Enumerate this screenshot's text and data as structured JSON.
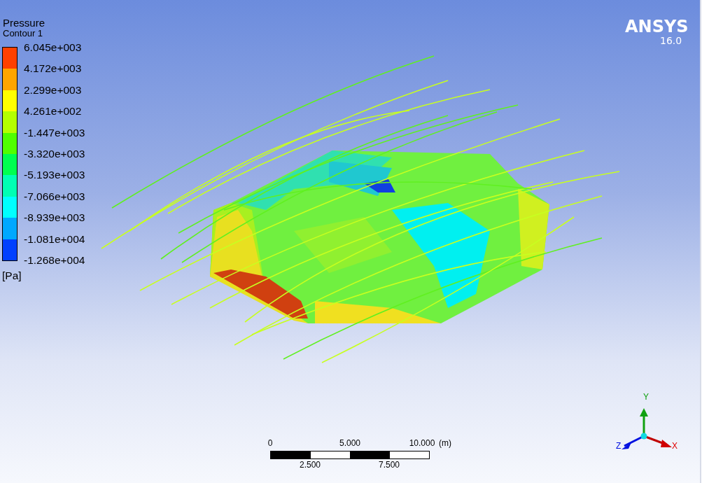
{
  "legend": {
    "title": "Pressure",
    "subtitle": "Contour 1",
    "labels": [
      "6.045e+003",
      "4.172e+003",
      "2.299e+003",
      "4.261e+002",
      "-1.447e+003",
      "-3.320e+003",
      "-5.193e+003",
      "-7.066e+003",
      "-8.939e+003",
      "-1.081e+004",
      "-1.268e+004"
    ],
    "bands": [
      {
        "color": "#ff4000"
      },
      {
        "color": "#ffa500"
      },
      {
        "color": "#ffff00"
      },
      {
        "color": "#b4ff00"
      },
      {
        "color": "#50ff00"
      },
      {
        "color": "#00ff50"
      },
      {
        "color": "#00ffb4"
      },
      {
        "color": "#00ffff"
      },
      {
        "color": "#00a8ff"
      },
      {
        "color": "#0040ff"
      }
    ],
    "unit": "[Pa]"
  },
  "logo": {
    "name": "ANSYS",
    "version": "16.0"
  },
  "scale_bar": {
    "top_labels": [
      "0",
      "5.000",
      "10.000"
    ],
    "unit": "(m)",
    "bottom_labels": [
      "2.500",
      "7.500"
    ]
  },
  "axes": {
    "x": "X",
    "y": "Y",
    "z": "Z"
  }
}
